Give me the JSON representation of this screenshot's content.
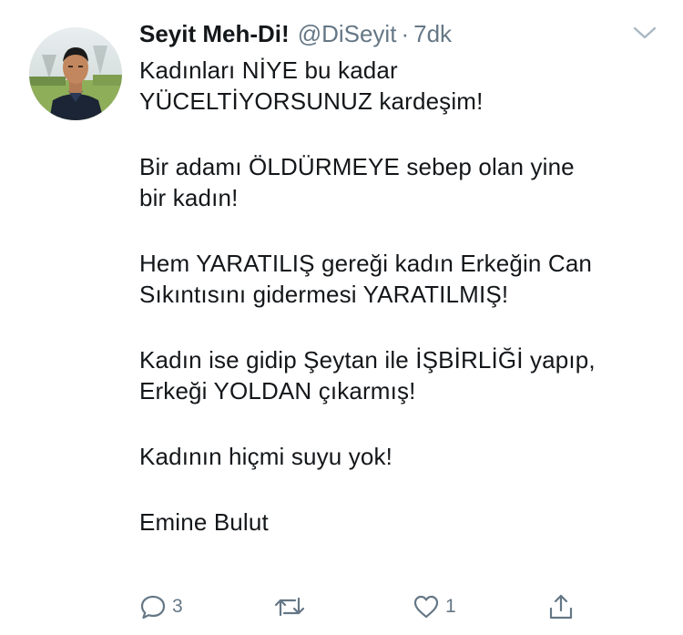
{
  "tweet": {
    "author_name": "Seyit Meh-Di!",
    "author_handle": "@DiSeyit",
    "separator": "·",
    "time": "7dk",
    "paragraphs": [
      [
        "Kadınları NİYE bu kadar",
        "YÜCELTİYORSUNUZ kardeşim!"
      ],
      [
        "Bir adamı ÖLDÜRMEYE sebep olan yine",
        "bir kadın!"
      ],
      [
        "Hem YARATILIŞ gereği kadın Erkeğin Can",
        "Sıkıntısını gidermesi YARATILMIŞ!"
      ],
      [
        "Kadın ise gidip Şeytan ile İŞBİRLİĞİ yapıp,",
        "Erkeği YOLDAN çıkarmış!"
      ],
      [
        "Kadının hiçmi suyu yok!"
      ],
      [
        "Emine Bulut"
      ]
    ]
  },
  "actions": {
    "reply_count": "3",
    "retweet_count": "",
    "like_count": "1"
  },
  "icons": {
    "avatar": "profile-photo",
    "more": "chevron-down-icon",
    "reply": "reply-icon",
    "retweet": "retweet-icon",
    "like": "heart-icon",
    "share": "share-icon"
  },
  "colors": {
    "text": "#14171a",
    "secondary": "#657786",
    "icon": "#657786"
  }
}
